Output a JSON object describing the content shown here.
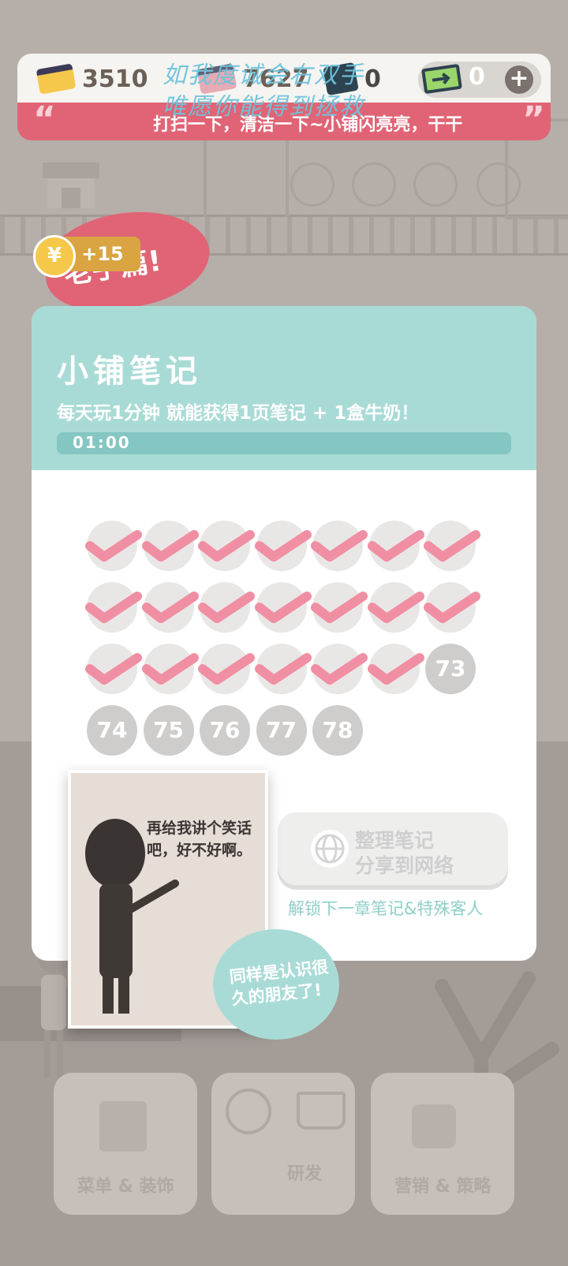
{
  "currency": {
    "cards": "3510",
    "fish": "7627",
    "phone": "0",
    "tickets": "0",
    "add": "+"
  },
  "ticker": {
    "open_quote": "“",
    "close_quote": "”",
    "text": "打扫一下，清洁一下~小铺闪亮亮，干干"
  },
  "watermark": {
    "line1": "如我度诚会右双手",
    "line2": "唯愿你能得到拯救"
  },
  "banner": {
    "text": "老手篇!",
    "coin_icon": "¥",
    "reward": "+15"
  },
  "card": {
    "title": "小铺笔记",
    "subtitle": "每天玩1分钟  就能获得1页笔记 + 1盒牛奶！",
    "timer": "01:00",
    "checked_count": 20,
    "locked_days": [
      "73",
      "74",
      "75",
      "76",
      "77",
      "78"
    ],
    "share_line1": "整理笔记",
    "share_line2": "分享到网络",
    "unlock_hint": "解锁下一章笔记&特殊客人"
  },
  "character": {
    "photo_text": "再给我讲个笑话吧，好不好啊。",
    "bubble_text": "同样是认识很久的朋友了!"
  },
  "menu": {
    "left": "菜单 & 装饰",
    "middle": "研发",
    "right": "营销 & 策略"
  },
  "colors": {
    "accent_teal": "#a9dbd6",
    "accent_pink": "#e06475",
    "check_pink": "#f08fa3"
  }
}
